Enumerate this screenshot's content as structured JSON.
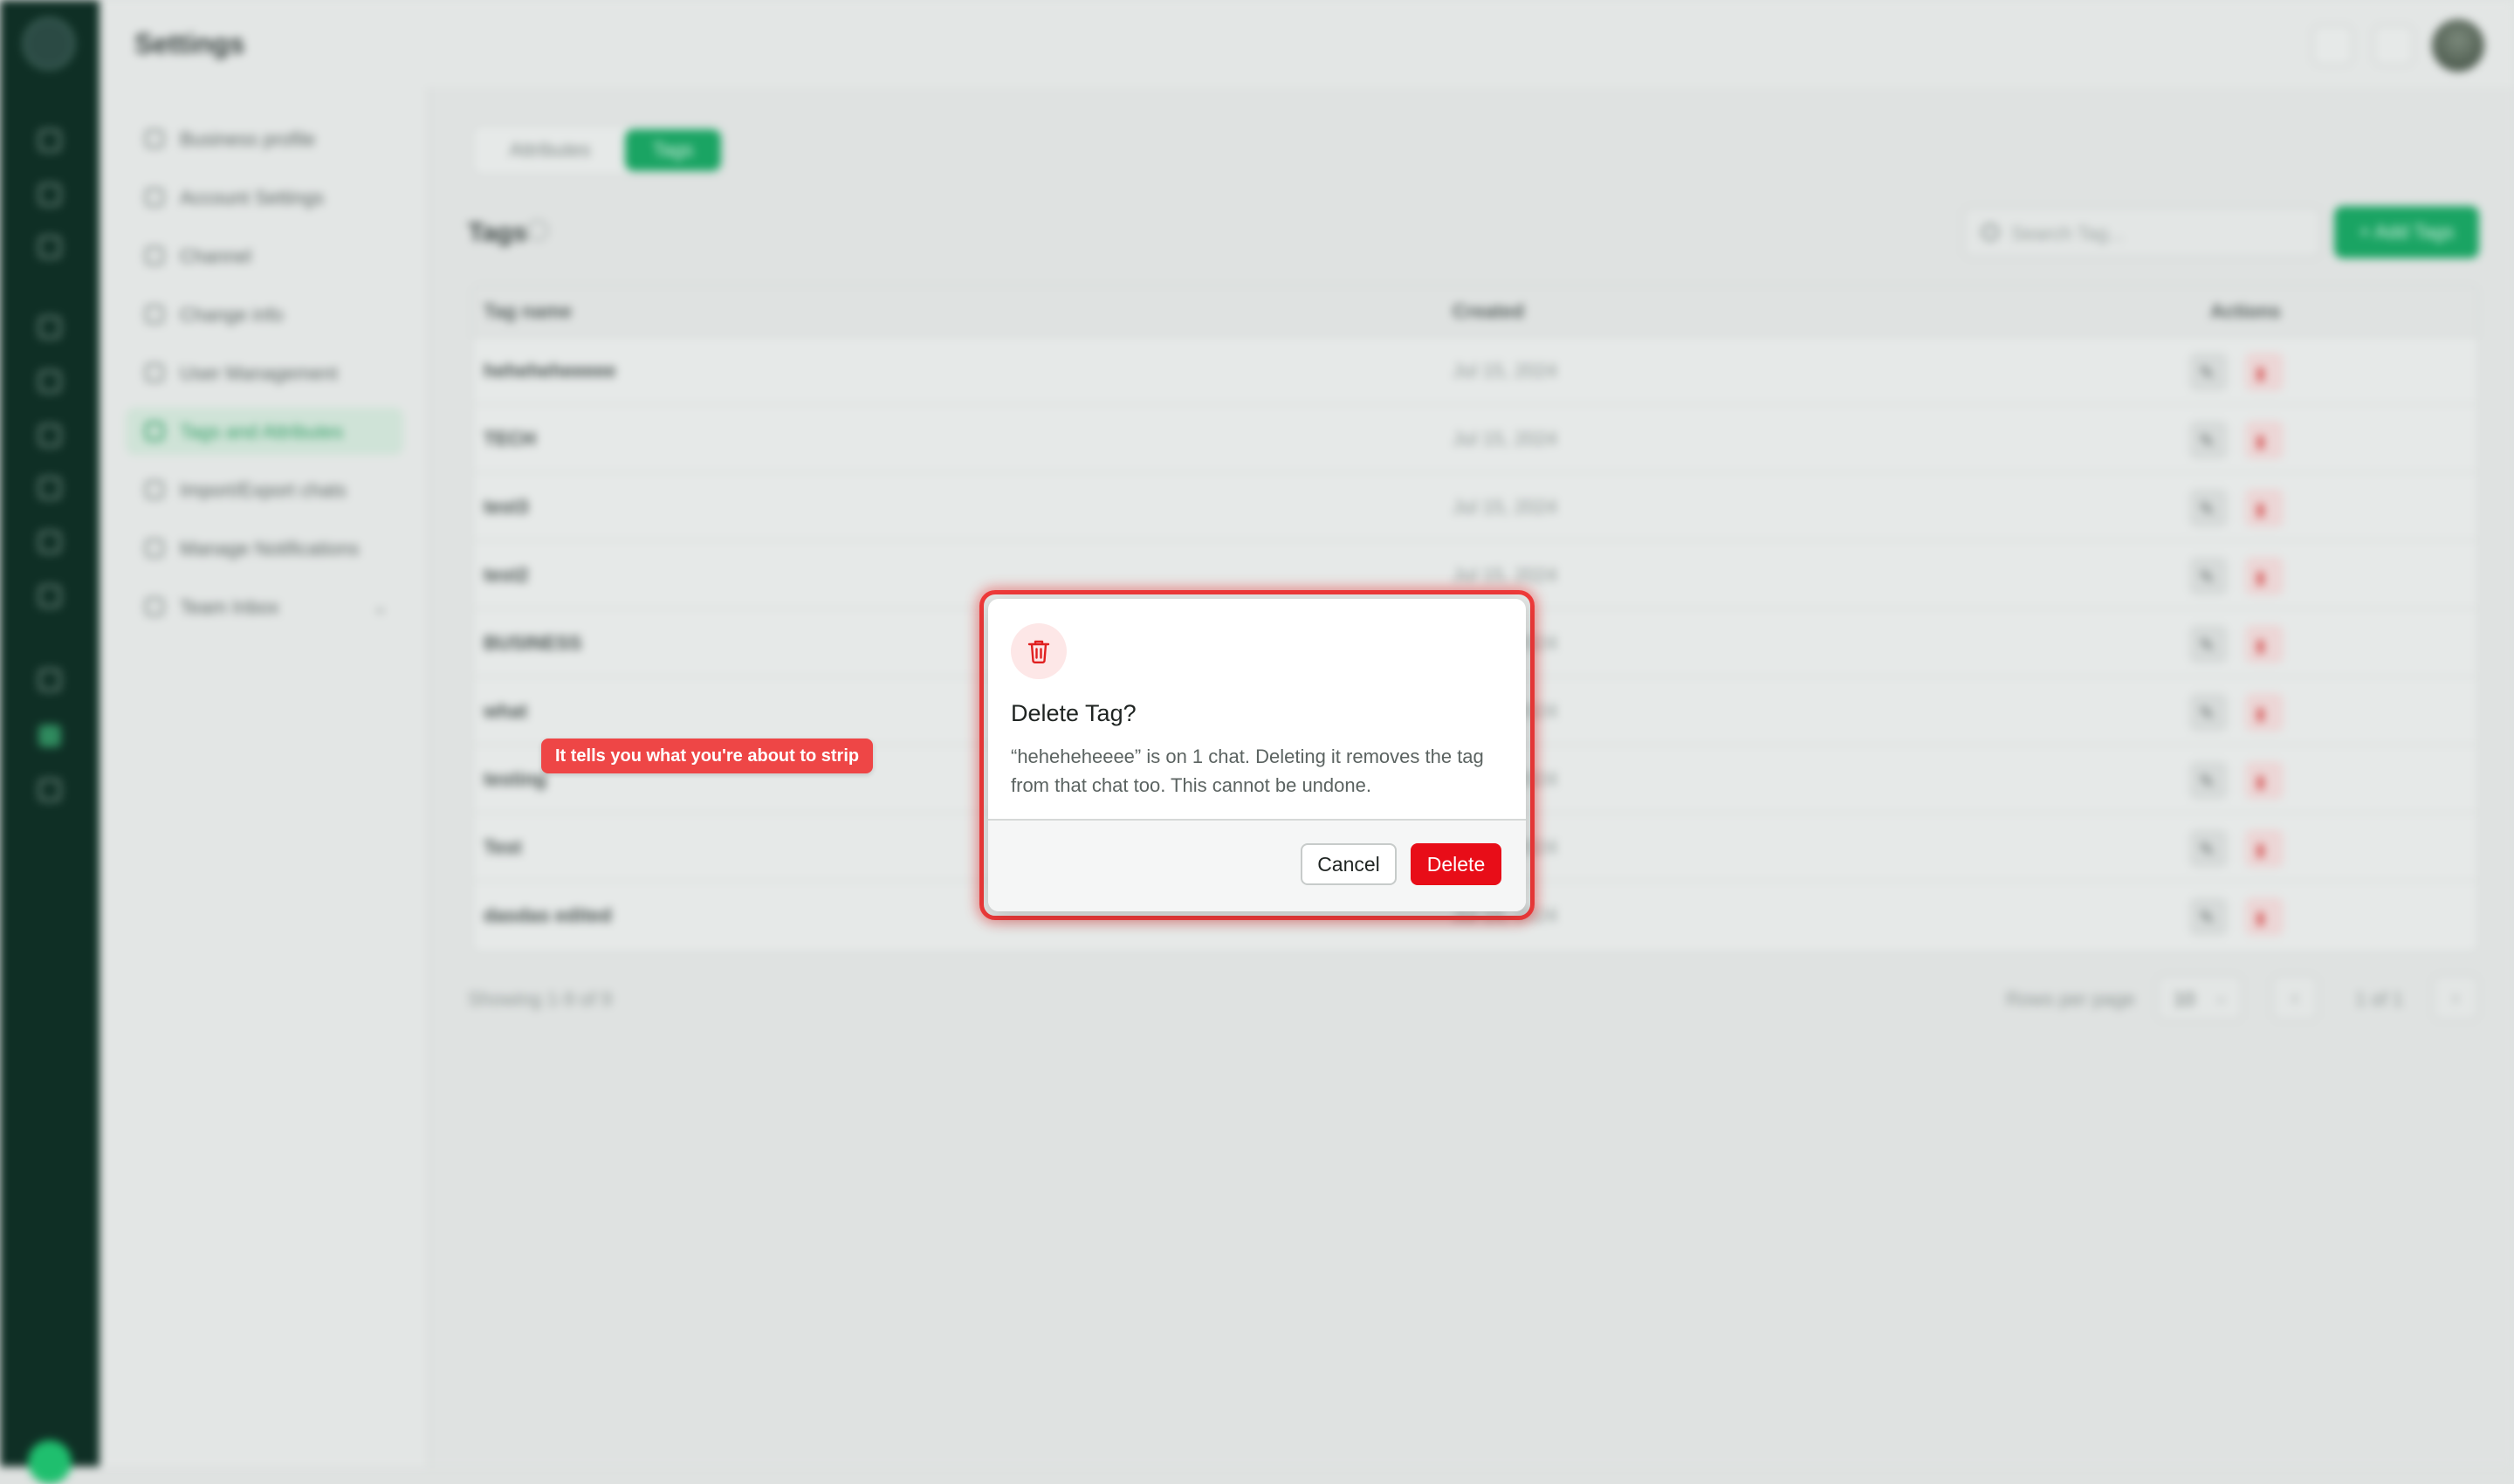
{
  "app": {
    "page_title": "Settings"
  },
  "settings_nav": {
    "items": [
      {
        "label": "Business profile"
      },
      {
        "label": "Account Settings"
      },
      {
        "label": "Channel"
      },
      {
        "label": "Change info"
      },
      {
        "label": "User Management"
      },
      {
        "label": "Tags and Attributes"
      },
      {
        "label": "Import/Export chats"
      },
      {
        "label": "Manage Notifications"
      },
      {
        "label": "Team Inbox"
      }
    ],
    "active_item": "Tags and Attributes"
  },
  "tabs": {
    "attributes": "Attributes",
    "tags": "Tags"
  },
  "section": {
    "title": "Tags",
    "search_placeholder": "Search Tag...",
    "add_button": "+ Add Tags"
  },
  "table": {
    "columns": {
      "name": "Tag name",
      "created": "Created",
      "actions": "Actions"
    },
    "rows": [
      {
        "name": "heheheheeeee",
        "created": "Jul 15, 2024"
      },
      {
        "name": "TECH",
        "created": "Jul 15, 2024"
      },
      {
        "name": "test3",
        "created": "Jul 15, 2024"
      },
      {
        "name": "test2",
        "created": "Jul 15, 2024"
      },
      {
        "name": "BUSINESS",
        "created": "Jul 15, 2024"
      },
      {
        "name": "what",
        "created": "Jul 15, 2024"
      },
      {
        "name": "testing",
        "created": "Jul 15, 2024"
      },
      {
        "name": "Test",
        "created": "Jul 15, 2024"
      },
      {
        "name": "dasdas edited",
        "created": "Jul 15, 2024"
      }
    ]
  },
  "footer": {
    "showing": "Showing 1-9 of 9",
    "rows_per_page_label": "Rows per page",
    "rows_per_page_value": "10",
    "page_indicator": "1 of 1",
    "prev": "‹",
    "next": "›"
  },
  "tooltip": {
    "text": "It tells you what you're about to strip"
  },
  "dialog": {
    "title": "Delete Tag?",
    "message": "“heheheheeee” is on 1 chat. Deleting it removes the tag from that chat too. This cannot be undone.",
    "cancel_label": "Cancel",
    "delete_label": "Delete",
    "icon": "trash-icon",
    "danger_color": "#e80d18"
  }
}
